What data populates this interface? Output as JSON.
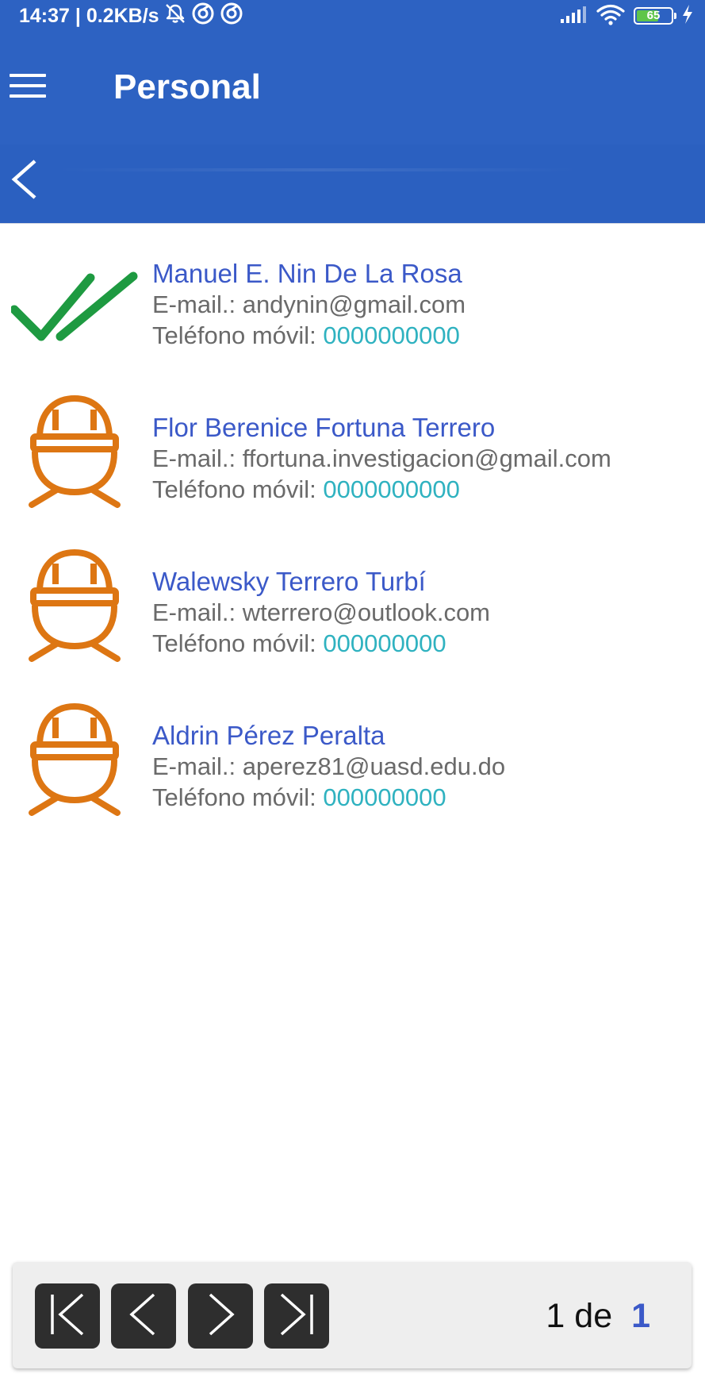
{
  "status_bar": {
    "time_speed": "14:37 | 0.2KB/s",
    "icons": [
      "alarm-off-icon",
      "sync-icon",
      "sync-icon",
      "signal-icon",
      "wifi-icon",
      "battery-icon",
      "charging-icon"
    ],
    "battery_level": "65",
    "battery_fill": 0.65,
    "battery_color": "#5fc54a"
  },
  "app_bar": {
    "title": "Personal",
    "color": "#2d62c2",
    "menu_icon": "hamburger-menu-icon",
    "back_icon": "chevron-left-icon"
  },
  "people": [
    {
      "name": "Manuel E. Nin De La Rosa",
      "email_label": "E-mail.:",
      "email": "andynin@gmail.com",
      "phone_label": "Teléfono móvil:",
      "phone": "0000000000",
      "icon": "double-check-icon"
    },
    {
      "name": "Flor Berenice Fortuna Terrero",
      "email_label": "E-mail.:",
      "email": "ffortuna.investigacion@gmail.com",
      "phone_label": "Teléfono móvil:",
      "phone": "0000000000",
      "icon": "worker-hardhat-icon"
    },
    {
      "name": "Walewsky Terrero Turbí",
      "email_label": "E-mail.:",
      "email": "wterrero@outlook.com",
      "phone_label": "Teléfono móvil:",
      "phone": "000000000",
      "icon": "worker-hardhat-icon"
    },
    {
      "name": "Aldrin Pérez Peralta",
      "email_label": "E-mail.:",
      "email": "aperez81@uasd.edu.do",
      "phone_label": "Teléfono móvil:",
      "phone": "000000000",
      "icon": "worker-hardhat-icon"
    }
  ],
  "pager": {
    "current_page": "1",
    "separator": "de",
    "total_pages": "1",
    "buttons": [
      "first-page-icon",
      "previous-page-icon",
      "next-page-icon",
      "last-page-icon"
    ]
  },
  "colors": {
    "name": "#3b59c8",
    "detail": "#6a6a6a",
    "phone": "#2fb2c0",
    "check": "#1e9a41",
    "worker": "#dd7613"
  }
}
